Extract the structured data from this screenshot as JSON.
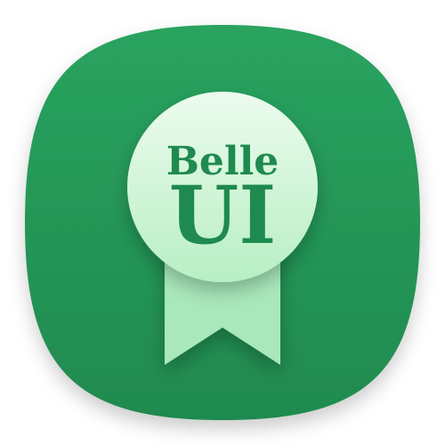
{
  "app_icon": {
    "word_top": "Belle",
    "word_bottom": "UI",
    "icon_name": "belle-ui-badge-icon",
    "colors": {
      "tile_top": "#2aa35f",
      "tile_bottom": "#1f8a4f",
      "tile_shadow": "#d7d7d7",
      "medal_fill_top": "#ecfbee",
      "medal_fill_bottom": "#b8efc4",
      "ribbon_fill": "#a9e8bb",
      "text_color": "#1f8a4f"
    }
  }
}
